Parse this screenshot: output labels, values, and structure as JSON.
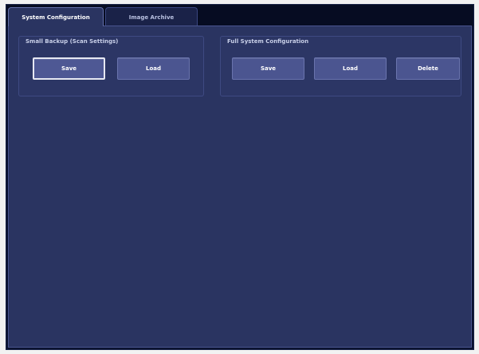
{
  "tabs": [
    {
      "label": "System Configuration",
      "active": true
    },
    {
      "label": "Image Archive",
      "active": false
    }
  ],
  "small_backup": {
    "title": "Small Backup (Scan Settings)",
    "save_label": "Save",
    "load_label": "Load"
  },
  "full_config": {
    "title": "Full System Configuration",
    "save_label": "Save",
    "load_label": "Load",
    "delete_label": "Delete"
  },
  "colors": {
    "panel_background": "#2a3461",
    "button_background": "#4b5590",
    "tabstrip_background": "#060c22"
  }
}
